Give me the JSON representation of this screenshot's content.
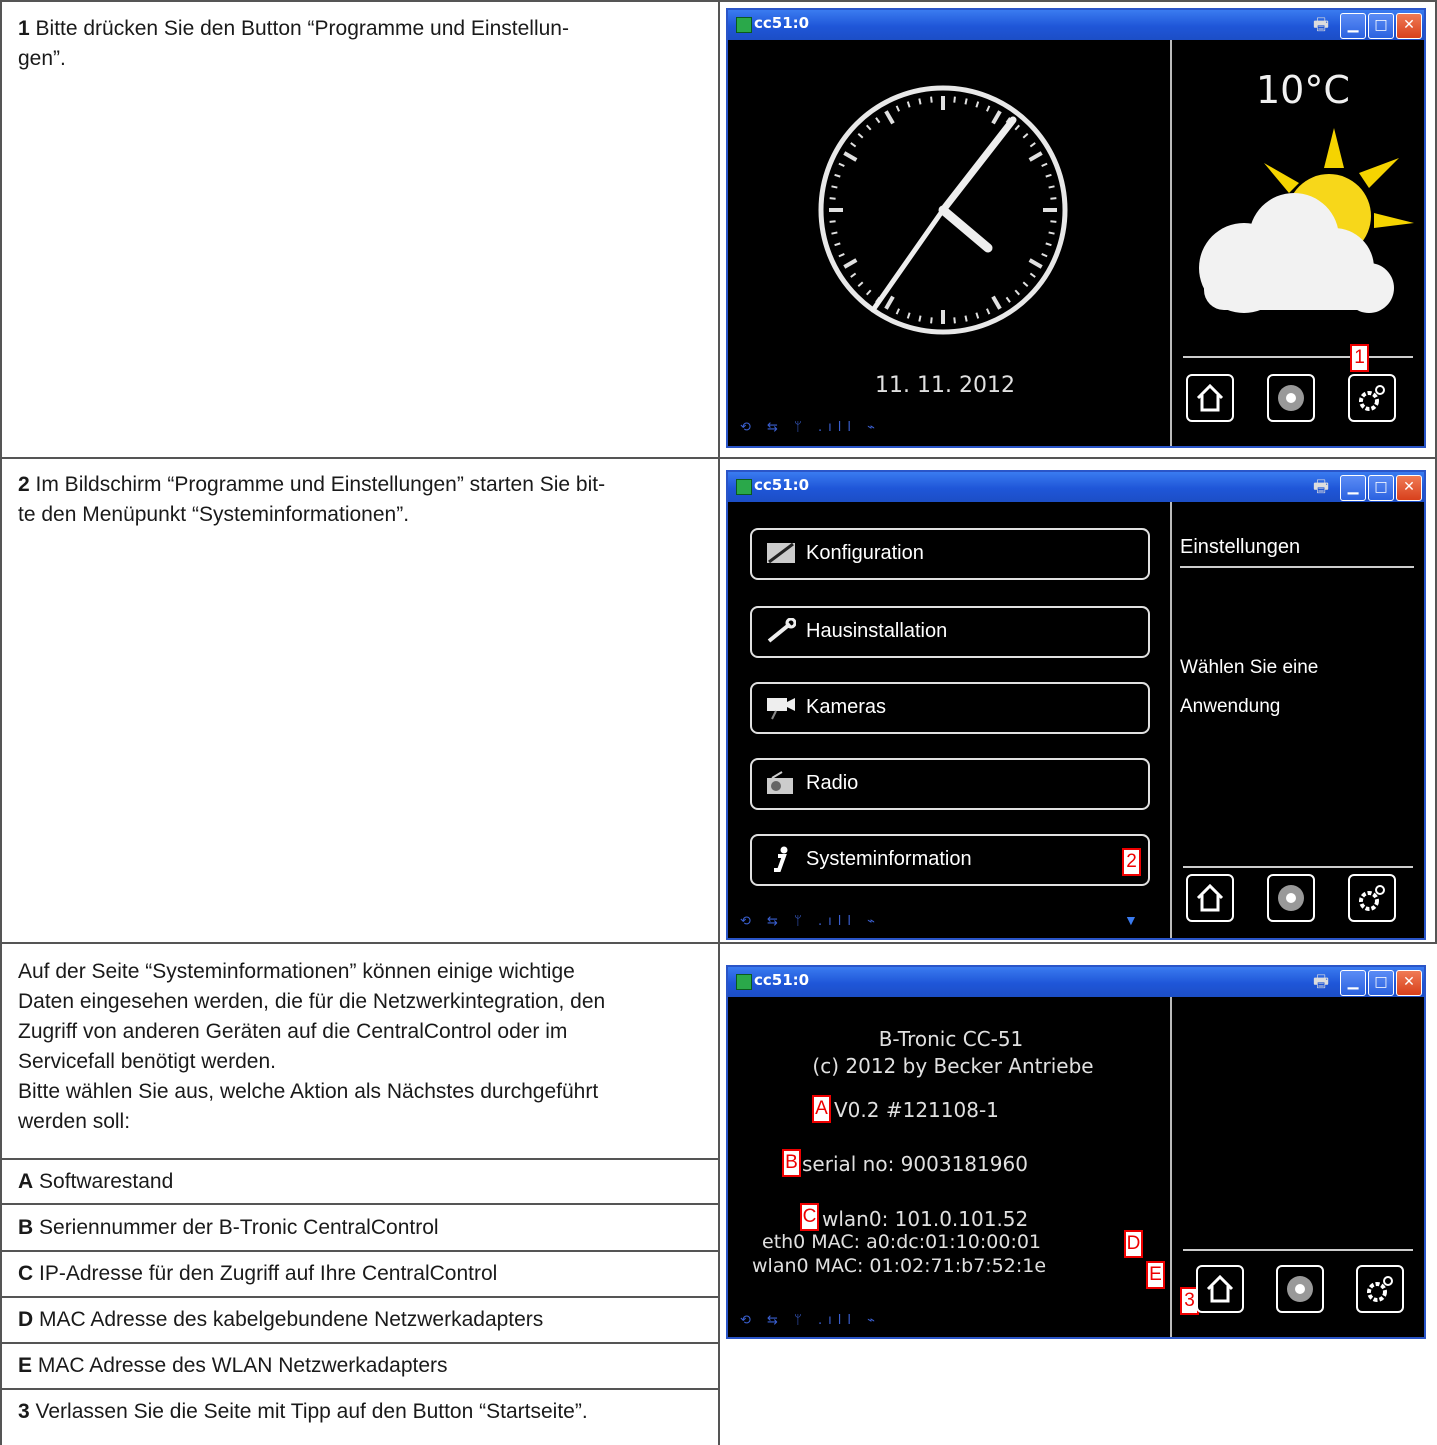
{
  "step1": {
    "num": "1",
    "text": " Bitte drücken Sie den Button “Programme und Einstellun-",
    "text2": "gen”."
  },
  "step2": {
    "num": "2",
    "text": " Im Bildschirm “Programme und Einstellungen” starten Sie bit-",
    "text2": "te den Menüpunkt “Systeminformationen”."
  },
  "intro": {
    "lines": [
      "Auf der Seite “Systeminformationen” können einige wichtige",
      "Daten eingesehen werden, die für die Netzwerkintegration, den",
      "Zugriff von anderen Geräten auf die CentralControl oder im",
      "Servicefall benötigt werden.",
      "Bitte wählen Sie aus, welche Aktion als Nächstes durchgeführt",
      "werden soll:"
    ]
  },
  "items": [
    {
      "key": "A",
      "text": " Softwarestand"
    },
    {
      "key": "B",
      "text": " Seriennummer der B-Tronic CentralControl"
    },
    {
      "key": "C",
      "text": " IP-Adresse für den Zugriff auf Ihre CentralControl"
    },
    {
      "key": "D",
      "text": " MAC Adresse des kabelgebundene Netzwerkadapters"
    },
    {
      "key": "E",
      "text": " MAC Adresse des WLAN Netzwerkadapters"
    },
    {
      "key": "3",
      "text": " Verlassen Sie die Seite mit Tipp auf den Button “Startseite”."
    }
  ],
  "window": {
    "title": "cc51:0"
  },
  "screen1": {
    "temperature": "10°C",
    "date": "11. 11. 2012",
    "marker": "1",
    "status": "⟲ ⇆ ᛘ .ıll ⌁"
  },
  "screen2": {
    "menu": [
      "Konfiguration",
      "Hausinstallation",
      "Kameras",
      "Radio",
      "Systeminformation"
    ],
    "panel_title": "Einstellungen",
    "panel_text1": "Wählen Sie eine",
    "panel_text2": "Anwendung",
    "marker": "2",
    "status": "⟲ ⇆ ᛘ .ıll ⌁",
    "scroll_arrow": "▼"
  },
  "screen3": {
    "product": "B-Tronic CC-51",
    "copyright": "(c) 2012 by Becker Antriebe",
    "version": "V0.2 #121108-1",
    "serial": "serial no: 9003181960",
    "wlan_ip": "wlan0: 101.0.101.52",
    "eth_mac": "eth0 MAC: a0:dc:01:10:00:01",
    "wlan_mac": "wlan0 MAC: 01:02:71:b7:52:1e",
    "markers": {
      "a": "A",
      "b": "B",
      "c": "C",
      "d": "D",
      "e": "E",
      "three": "3"
    },
    "status": "⟲ ⇆ ᛘ .ıll ⌁"
  },
  "colors": {
    "titlebar": "#1f56d8",
    "marker": "#e00000",
    "screen_bg": "#000000",
    "sun": "#f5d400"
  }
}
